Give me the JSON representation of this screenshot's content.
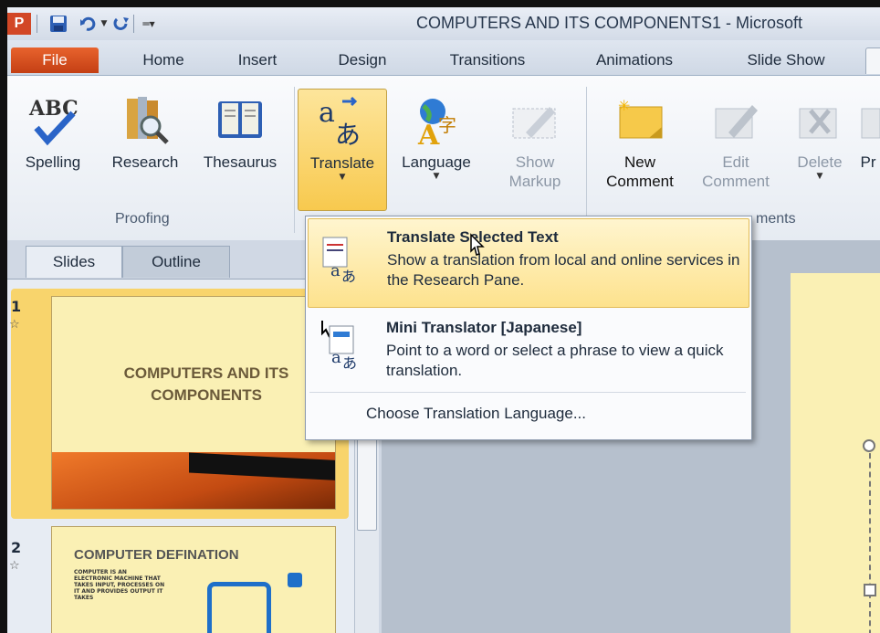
{
  "title_bar": {
    "app_icon_letter": "P",
    "document_title": "COMPUTERS AND ITS COMPONENTS1  -  Microsoft",
    "icons": [
      "powerpoint-icon",
      "save-icon",
      "undo-icon",
      "redo-icon",
      "customize-qat-icon"
    ]
  },
  "tabs": [
    {
      "label": "File",
      "active": false
    },
    {
      "label": "Home"
    },
    {
      "label": "Insert"
    },
    {
      "label": "Design"
    },
    {
      "label": "Transitions"
    },
    {
      "label": "Animations"
    },
    {
      "label": "Slide Show"
    }
  ],
  "ribbon": {
    "buttons": [
      {
        "label": "Spelling",
        "icon": "spelling-abc-icon"
      },
      {
        "label": "Research",
        "icon": "research-book-icon"
      },
      {
        "label": "Thesaurus",
        "icon": "thesaurus-book-icon"
      },
      {
        "label": "Translate",
        "icon": "translate-icon",
        "has_dropdown": true,
        "active": true
      },
      {
        "label": "Language",
        "icon": "language-globe-icon",
        "has_dropdown": true
      },
      {
        "label_line1": "Show",
        "label_line2": "Markup",
        "icon": "show-markup-icon",
        "disabled": true
      },
      {
        "label_line1": "New",
        "label_line2": "Comment",
        "icon": "new-comment-icon"
      },
      {
        "label_line1": "Edit",
        "label_line2": "Comment",
        "icon": "edit-comment-icon",
        "disabled": true
      },
      {
        "label": "Delete",
        "icon": "delete-comment-icon",
        "disabled": true,
        "has_dropdown": true
      },
      {
        "label": "Pr",
        "icon": "previous-icon"
      }
    ],
    "groups": [
      "Proofing",
      "ments"
    ]
  },
  "pane_tabs": [
    "Slides",
    "Outline"
  ],
  "slides": [
    {
      "number": "1",
      "title_line1": "COMPUTERS AND ITS",
      "title_line2": "COMPONENTS"
    },
    {
      "number": "2",
      "title": "COMPUTER  DEFINATION",
      "body": "COMPUTER IS AN ELECTRONIC MACHINE THAT TAKES INPUT, PROCESSES ON IT AND PROVIDES OUTPUT IT TAKES"
    }
  ],
  "translate_menu": {
    "items": [
      {
        "title": "Translate Selected Text",
        "description": "Show a translation from local and online services in the Research Pane.",
        "highlighted": true
      },
      {
        "title": "Mini Translator [Japanese]",
        "description": "Point to a word or select a phrase to view a quick translation."
      },
      {
        "title": "Choose Translation Language..."
      }
    ]
  },
  "colors": {
    "file_tab": "#d24726",
    "menu_highlight": "#fde28d",
    "slide_background": "#faf0b4",
    "accent_orange": "#e5621f"
  }
}
